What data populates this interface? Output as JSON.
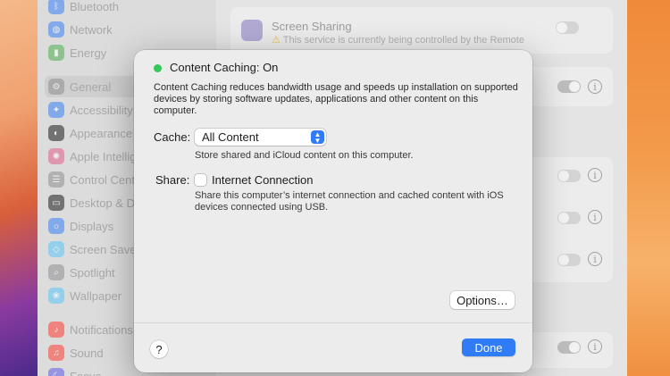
{
  "sidebar": {
    "items": [
      {
        "label": "Bluetooth",
        "icon": "bluetooth-icon",
        "color": "#3a82f7"
      },
      {
        "label": "Network",
        "icon": "globe-icon",
        "color": "#3a82f7"
      },
      {
        "label": "Energy",
        "icon": "battery-icon",
        "color": "#4caf50"
      },
      {
        "label": "General",
        "icon": "gear-icon",
        "color": "#8e8e93"
      },
      {
        "label": "Accessibility",
        "icon": "accessibility-icon",
        "color": "#3a82f7"
      },
      {
        "label": "Appearance",
        "icon": "appearance-icon",
        "color": "#1c1c1e"
      },
      {
        "label": "Apple Intellig",
        "icon": "apple-intelligence-icon",
        "color": "#e0608a"
      },
      {
        "label": "Control Cent",
        "icon": "control-center-icon",
        "color": "#8e8e93"
      },
      {
        "label": "Desktop & D",
        "icon": "desktop-icon",
        "color": "#1c1c1e"
      },
      {
        "label": "Displays",
        "icon": "display-icon",
        "color": "#3a82f7"
      },
      {
        "label": "Screen Save",
        "icon": "screen-saver-icon",
        "color": "#5ac8fa"
      },
      {
        "label": "Spotlight",
        "icon": "spotlight-icon",
        "color": "#8e8e93"
      },
      {
        "label": "Wallpaper",
        "icon": "wallpaper-icon",
        "color": "#5ac8fa"
      },
      {
        "label": "Notifications",
        "icon": "bell-icon",
        "color": "#ff3b30"
      },
      {
        "label": "Sound",
        "icon": "speaker-icon",
        "color": "#ff3b30"
      },
      {
        "label": "Focus",
        "icon": "moon-icon",
        "color": "#5e5ce6"
      }
    ]
  },
  "background_content": {
    "screen_sharing_title": "Screen Sharing",
    "screen_sharing_subtitle": "This service is currently being controlled by the Remote"
  },
  "modal": {
    "title": "Content Caching: On",
    "status_color": "#34c759",
    "description": "Content Caching reduces bandwidth usage and speeds up installation on supported devices by storing software updates, applications and other content on this computer.",
    "cache_label": "Cache:",
    "cache_value": "All Content",
    "cache_hint": "Store shared and iCloud content on this computer.",
    "share_label": "Share:",
    "share_checkbox_label": "Internet Connection",
    "share_checked": false,
    "share_hint": "Share this computer’s internet connection and cached content with iOS devices connected using USB.",
    "options_label": "Options…",
    "help_label": "?",
    "done_label": "Done",
    "accent_color": "#2f7cf6"
  }
}
